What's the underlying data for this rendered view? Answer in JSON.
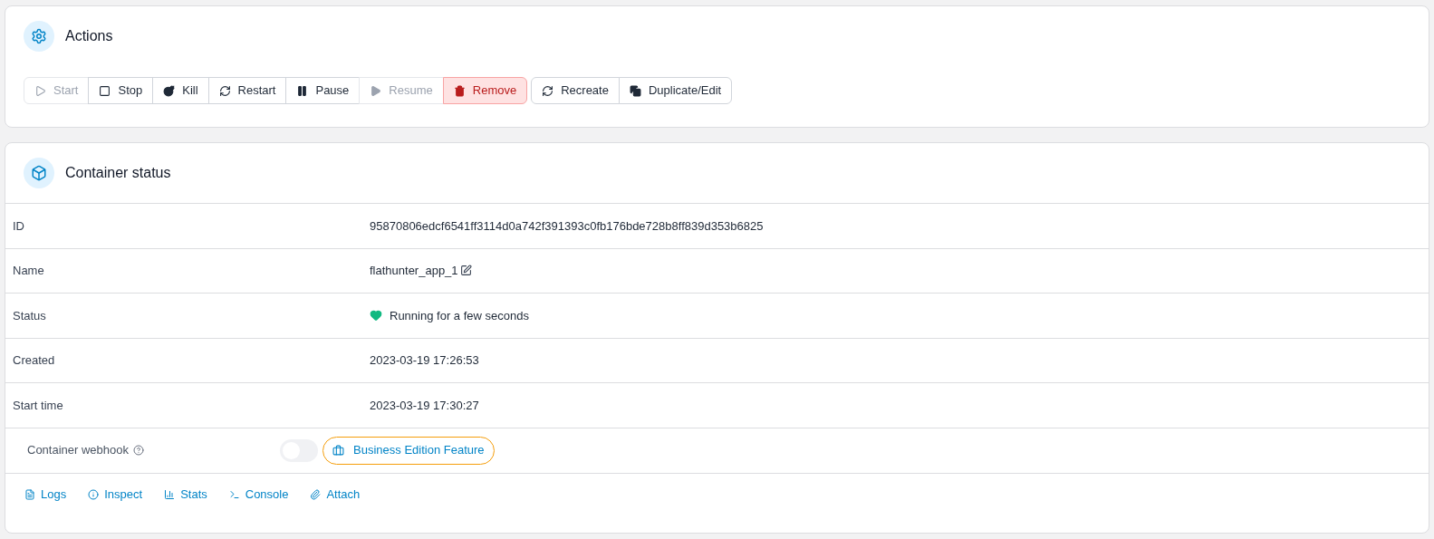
{
  "actions": {
    "title": "Actions",
    "groups": [
      [
        {
          "label": "Start",
          "kind": "start",
          "disabled": true,
          "danger": false
        },
        {
          "label": "Stop",
          "kind": "stop",
          "disabled": false,
          "danger": false
        },
        {
          "label": "Kill",
          "kind": "kill",
          "disabled": false,
          "danger": false
        },
        {
          "label": "Restart",
          "kind": "restart",
          "disabled": false,
          "danger": false
        },
        {
          "label": "Pause",
          "kind": "pause",
          "disabled": false,
          "danger": false
        },
        {
          "label": "Resume",
          "kind": "resume",
          "disabled": true,
          "danger": false
        },
        {
          "label": "Remove",
          "kind": "remove",
          "disabled": false,
          "danger": true
        }
      ],
      [
        {
          "label": "Recreate",
          "kind": "restart",
          "disabled": false,
          "danger": false
        },
        {
          "label": "Duplicate/Edit",
          "kind": "duplicate",
          "disabled": false,
          "danger": false
        }
      ]
    ]
  },
  "status": {
    "title": "Container status",
    "rows": [
      {
        "label": "ID",
        "value": "95870806edcf6541ff3114d0a742f391393c0fb176bde728b8ff839d353b6825",
        "kind": "text"
      },
      {
        "label": "Name",
        "value": "flathunter_app_1",
        "kind": "editable"
      },
      {
        "label": "Status",
        "value": "Running for a few seconds",
        "kind": "health"
      },
      {
        "label": "Created",
        "value": "2023-03-19 17:26:53",
        "kind": "text"
      },
      {
        "label": "Start time",
        "value": "2023-03-19 17:30:27",
        "kind": "text"
      }
    ],
    "webhook": {
      "label": "Container webhook",
      "on": false,
      "badge": "Business Edition Feature"
    },
    "links": [
      {
        "label": "Logs",
        "kind": "logs"
      },
      {
        "label": "Inspect",
        "kind": "inspect"
      },
      {
        "label": "Stats",
        "kind": "stats"
      },
      {
        "label": "Console",
        "kind": "console"
      },
      {
        "label": "Attach",
        "kind": "attach"
      }
    ]
  }
}
